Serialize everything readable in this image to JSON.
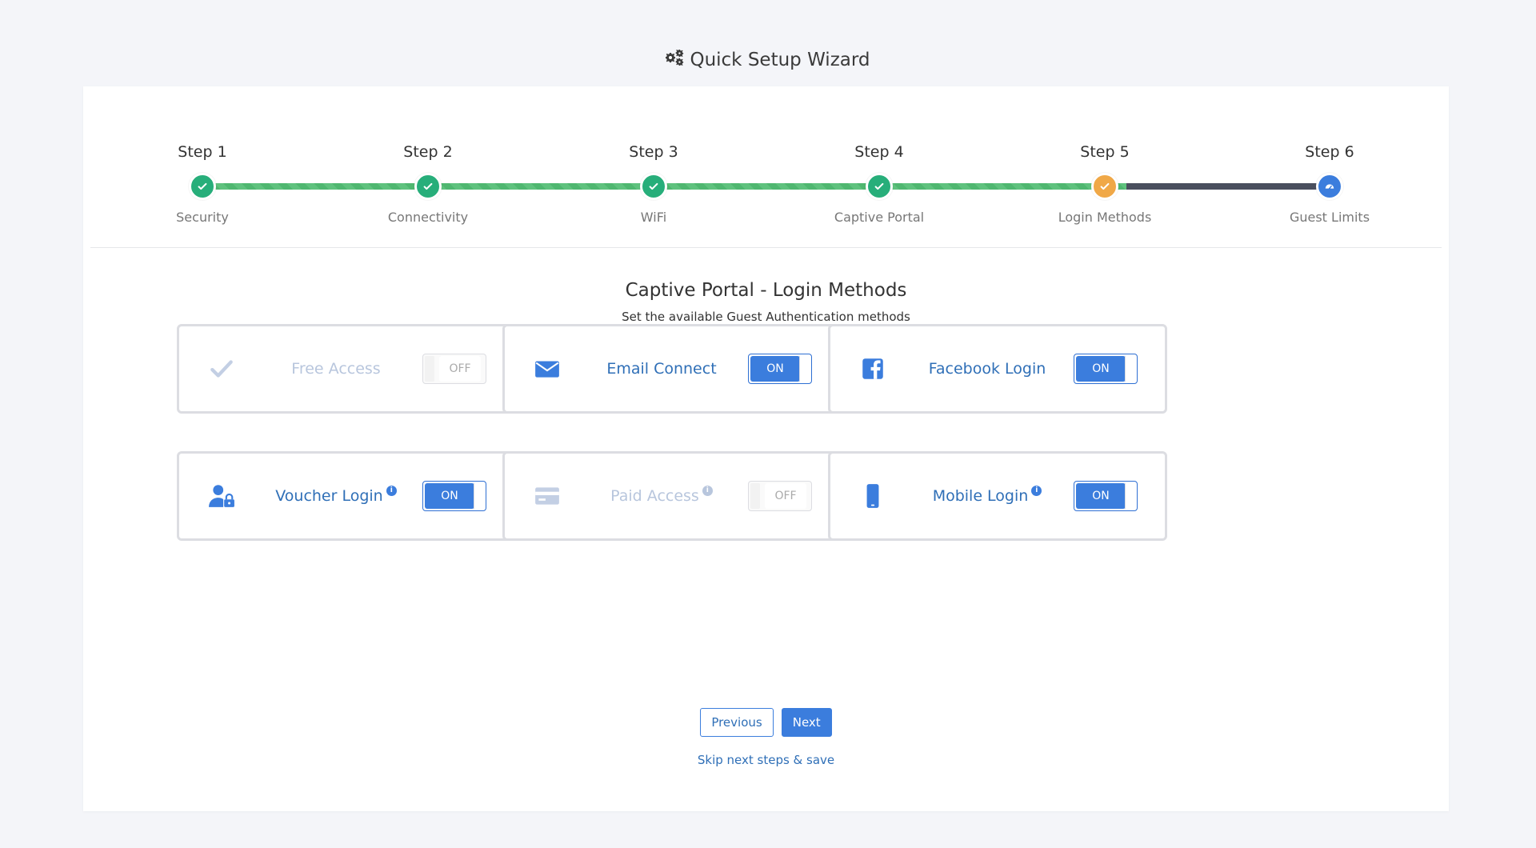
{
  "header": {
    "title": "Quick Setup Wizard",
    "icon": "gears-icon"
  },
  "stepper": {
    "progress_fraction": 0.82,
    "colors": {
      "done": "#27ae7a",
      "current": "#f0a847",
      "next": "#3b7ddd",
      "track_done": "#5fc27e",
      "track_todo": "#4a4f5e"
    },
    "steps": [
      {
        "label": "Step 1",
        "name": "Security",
        "status": "done"
      },
      {
        "label": "Step 2",
        "name": "Connectivity",
        "status": "done"
      },
      {
        "label": "Step 3",
        "name": "WiFi",
        "status": "done"
      },
      {
        "label": "Step 4",
        "name": "Captive Portal",
        "status": "done"
      },
      {
        "label": "Step 5",
        "name": "Login Methods",
        "status": "current"
      },
      {
        "label": "Step 6",
        "name": "Guest Limits",
        "status": "upcoming"
      }
    ]
  },
  "section": {
    "title": "Captive Portal - Login Methods",
    "subtitle": "Set the available Guest Authentication methods"
  },
  "methods": [
    {
      "label": "Free Access",
      "icon": "check-icon",
      "state": "OFF",
      "info": false
    },
    {
      "label": "Email Connect",
      "icon": "envelope-icon",
      "state": "ON",
      "info": false
    },
    {
      "label": "Facebook Login",
      "icon": "facebook-icon",
      "state": "ON",
      "info": false
    },
    {
      "label": "Voucher Login",
      "icon": "user-lock-icon",
      "state": "ON",
      "info": true
    },
    {
      "label": "Paid Access",
      "icon": "credit-card-icon",
      "state": "OFF",
      "info": true
    },
    {
      "label": "Mobile Login",
      "icon": "mobile-icon",
      "state": "ON",
      "info": true
    }
  ],
  "actions": {
    "previous_label": "Previous",
    "next_label": "Next",
    "skip_label": "Skip next steps & save"
  },
  "info_glyph": "i"
}
